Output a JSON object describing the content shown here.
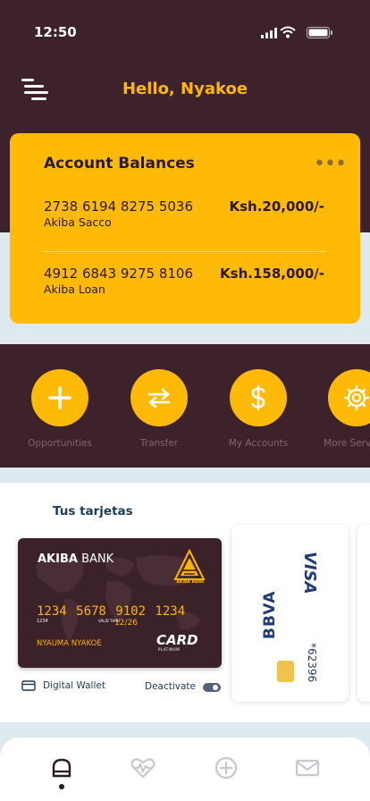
{
  "status_bar": {
    "time": "12:50"
  },
  "header": {
    "greeting": "Hello, Nyakoe"
  },
  "balances": {
    "title": "Account Balances",
    "more_icon": "ellipsis-icon",
    "accounts": [
      {
        "number": "2738 6194 8275 5036",
        "name": "Akiba Sacco",
        "amount": "Ksh.20,000/-"
      },
      {
        "number": "4912 6843 9275 8106",
        "name": "Akiba Loan",
        "amount": "Ksh.158,000/-"
      }
    ]
  },
  "actions": [
    {
      "label": "Opportunities",
      "icon": "plus-icon"
    },
    {
      "label": "Transfer",
      "icon": "transfer-icon"
    },
    {
      "label": "My Accounts",
      "icon": "dollar-icon"
    },
    {
      "label": "More Services",
      "icon": "gear-icon"
    }
  ],
  "cards": {
    "title": "Tus tarjetas",
    "akiba_card": {
      "bank_bold": "AKIBA",
      "bank_rest": " BANK",
      "number": "1234 5678 9102 1234",
      "small_digits": "1234",
      "valid_thru": "VALID THRU",
      "expiry": "12/26",
      "holder": "NYAUMA NYAKOE",
      "card_word": "CARD",
      "tier": "PLATINUM",
      "logo_text": "AKIBA BANK"
    },
    "wallet_label": "Digital Wallet",
    "deactivate_label": "Deactivate",
    "toggle_on": true,
    "second_card": {
      "network": "VISA",
      "brand": "BBVA",
      "last_digits": "*62396"
    }
  },
  "colors": {
    "primary_dark": "#3d222c",
    "accent_yellow": "#ffba08",
    "navy": "#1d3c5b"
  },
  "tabbar": [
    {
      "name": "home",
      "icon": "home-icon",
      "active": true
    },
    {
      "name": "health",
      "icon": "heart-pulse-icon",
      "active": false
    },
    {
      "name": "add",
      "icon": "plus-circle-icon",
      "active": false
    },
    {
      "name": "messages",
      "icon": "mail-icon",
      "active": false
    }
  ]
}
